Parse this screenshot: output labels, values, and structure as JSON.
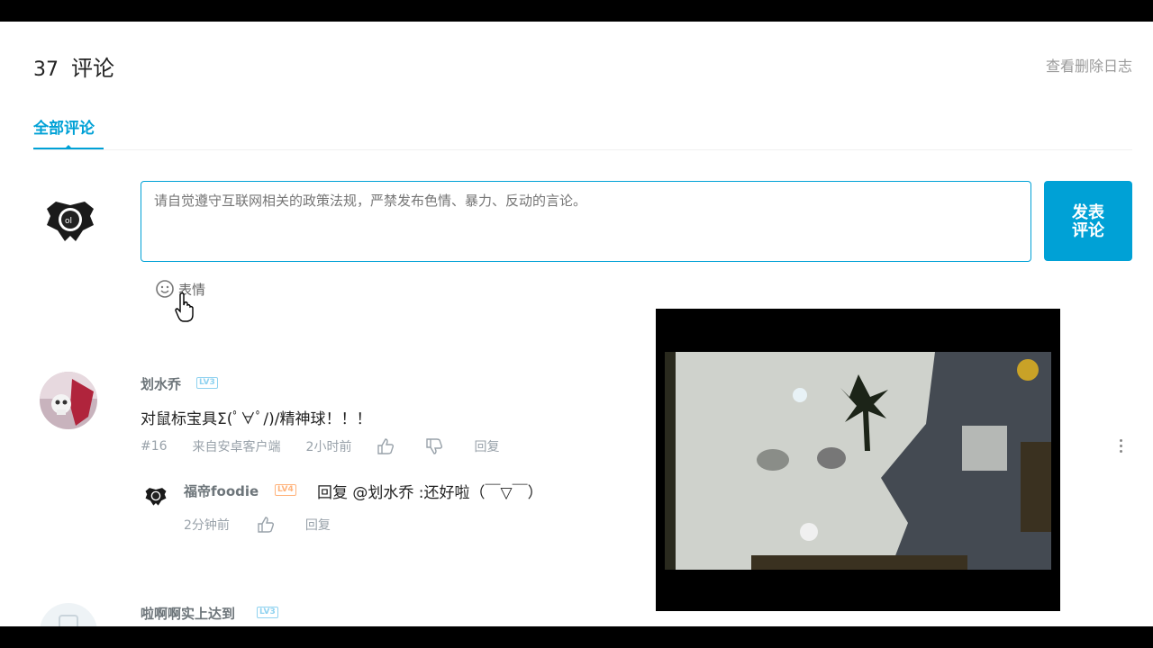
{
  "header": {
    "count": "37",
    "label": "评论",
    "delete_log": "查看删除日志"
  },
  "tabs": [
    {
      "label": "全部评论",
      "active": true
    }
  ],
  "composer": {
    "placeholder": "请自觉遵守互联网相关的政策法规，严禁发布色情、暴力、反动的言论。",
    "submit_label": "发表评论",
    "emoji_label": "表情"
  },
  "comments": [
    {
      "user": "划水乔",
      "level": "LV3",
      "text": "对鼠标宝具Σ(ﾟ∀ﾟ/)/精神球！！！",
      "floor": "#16",
      "source": "来自安卓客户端",
      "time": "2小时前",
      "reply_label": "回复",
      "replies": [
        {
          "user": "福帝foodie",
          "level": "LV4",
          "text": "回复 @划水乔 :还好啦（￣▽￣）",
          "time": "2分钟前",
          "reply_label": "回复"
        }
      ]
    },
    {
      "user": "啦啊啊实上达到",
      "level": "LV3"
    }
  ],
  "colors": {
    "accent": "#00a1d6",
    "level3": "#8fd2f0",
    "level4": "#ffb37c",
    "meta": "#99a2aa"
  },
  "icons": [
    "smile-icon",
    "hand-cursor-icon",
    "thumb-up-icon",
    "thumb-down-icon",
    "more-vertical-icon"
  ]
}
